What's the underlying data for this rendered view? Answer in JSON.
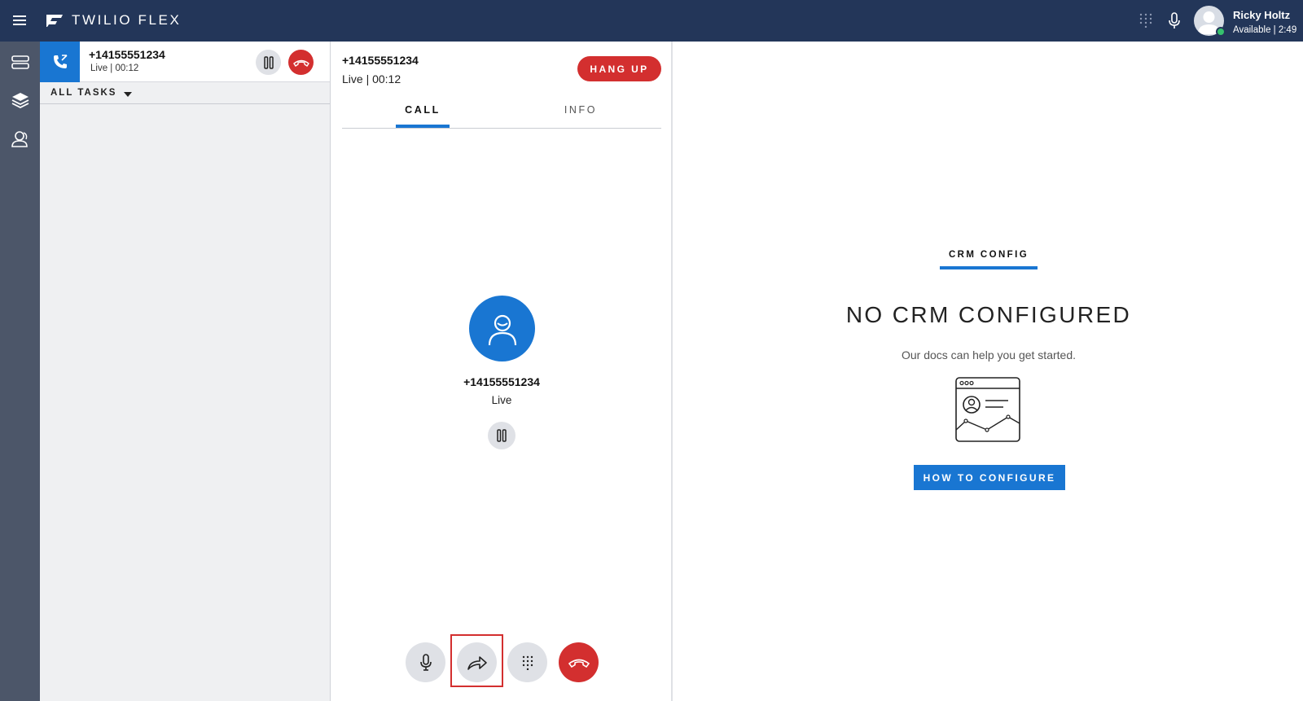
{
  "header": {
    "app_title": "TWILIO FLEX",
    "user_name": "Ricky Holtz",
    "user_status": "Available | 2:49",
    "status_color": "#36c26e"
  },
  "task_list": {
    "task": {
      "number": "+14155551234",
      "status": "Live | 00:12"
    },
    "filter_label": "ALL TASKS"
  },
  "call_panel": {
    "number": "+14155551234",
    "status": "Live | 00:12",
    "hangup_label": "HANG UP",
    "tabs": [
      {
        "label": "CALL",
        "active": true
      },
      {
        "label": "INFO",
        "active": false
      }
    ],
    "caller_number": "+14155551234",
    "caller_status": "Live"
  },
  "crm": {
    "tab_label": "CRM CONFIG",
    "title": "NO CRM CONFIGURED",
    "subtitle": "Our docs can help you get started.",
    "button_label": "HOW TO CONFIGURE"
  },
  "icons": {
    "hamburger": "menu-icon",
    "logo": "twilio-flex-logo-icon",
    "dialpad": "dialpad-icon",
    "mic": "microphone-icon",
    "transfer": "transfer-icon",
    "hold": "pause-icon",
    "hangup": "phone-hangup-icon"
  },
  "colors": {
    "header_bg": "#233659",
    "accent": "#1976d2",
    "danger": "#d32f2f",
    "nav_bg": "#4c5669"
  }
}
